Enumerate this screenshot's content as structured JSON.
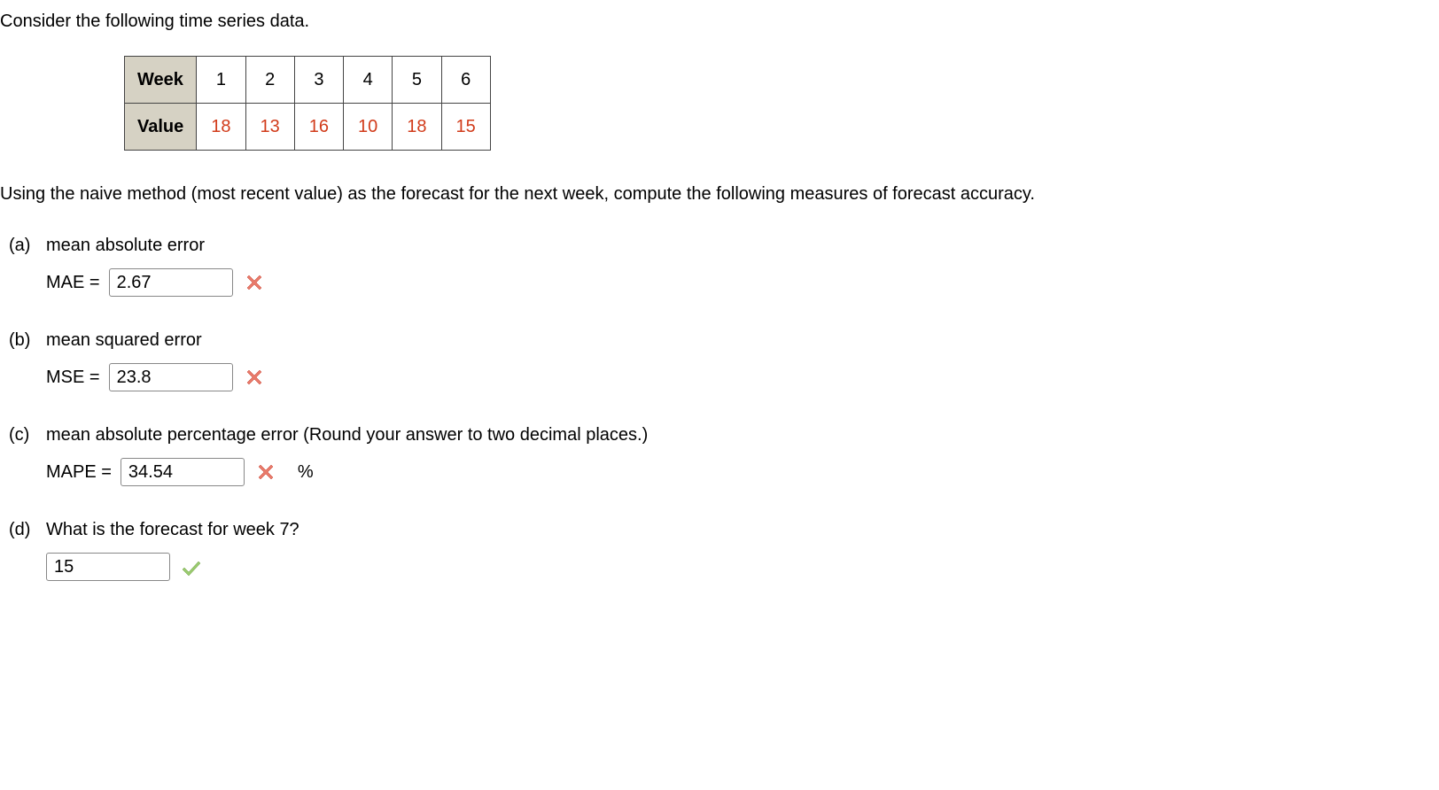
{
  "intro": "Consider the following time series data.",
  "table": {
    "row1_label": "Week",
    "row2_label": "Value",
    "weeks": [
      "1",
      "2",
      "3",
      "4",
      "5",
      "6"
    ],
    "values": [
      "18",
      "13",
      "16",
      "10",
      "18",
      "15"
    ]
  },
  "instruction": "Using the naive method (most recent value) as the forecast for the next week, compute the following measures of forecast accuracy.",
  "questions": {
    "a": {
      "label": "(a)",
      "title": "mean absolute error",
      "prefix": "MAE =",
      "value": "2.67",
      "suffix": "",
      "feedback": "wrong"
    },
    "b": {
      "label": "(b)",
      "title": "mean squared error",
      "prefix": "MSE =",
      "value": "23.8",
      "suffix": "",
      "feedback": "wrong"
    },
    "c": {
      "label": "(c)",
      "title": "mean absolute percentage error (Round your answer to two decimal places.)",
      "prefix": "MAPE =",
      "value": "34.54",
      "suffix": "%",
      "feedback": "wrong"
    },
    "d": {
      "label": "(d)",
      "title": "What is the forecast for week 7?",
      "prefix": "",
      "value": "15",
      "suffix": "",
      "feedback": "correct"
    }
  },
  "chart_data": {
    "type": "table",
    "categories": [
      "1",
      "2",
      "3",
      "4",
      "5",
      "6"
    ],
    "values": [
      18,
      13,
      16,
      10,
      18,
      15
    ],
    "title": "Time series data",
    "xlabel": "Week",
    "ylabel": "Value"
  }
}
